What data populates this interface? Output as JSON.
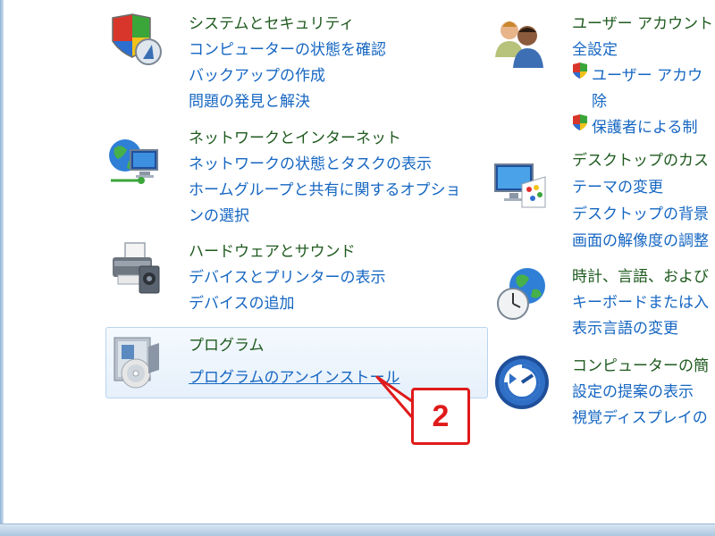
{
  "left": {
    "system": {
      "title": "システムとセキュリティ",
      "links": [
        "コンピューターの状態を確認",
        "バックアップの作成",
        "問題の発見と解決"
      ]
    },
    "network": {
      "title": "ネットワークとインターネット",
      "links": [
        "ネットワークの状態とタスクの表示",
        "ホームグループと共有に関するオプショ",
        "ンの選択"
      ]
    },
    "hardware": {
      "title": "ハードウェアとサウンド",
      "links": [
        "デバイスとプリンターの表示",
        "デバイスの追加"
      ]
    },
    "programs": {
      "title": "プログラム",
      "links": [
        "プログラムのアンインストール"
      ]
    }
  },
  "right": {
    "user": {
      "title": "ユーザー アカウント",
      "links": [
        "全設定",
        "ユーザー アカウ",
        "除",
        "保護者による制"
      ]
    },
    "desktop": {
      "title": "デスクトップのカス",
      "links": [
        "テーマの変更",
        "デスクトップの背景",
        "画面の解像度の調整"
      ]
    },
    "clock": {
      "title": "時計、言語、および",
      "links": [
        "キーボードまたは入",
        "表示言語の変更"
      ]
    },
    "ease": {
      "title": "コンピューターの簡",
      "links": [
        "設定の提案の表示",
        "視覚ディスプレイの"
      ]
    }
  },
  "callout": {
    "number": "2",
    "color": "#e01a1a"
  },
  "colors": {
    "title_green": "#1e5a1e",
    "link_blue": "#1566c2"
  }
}
